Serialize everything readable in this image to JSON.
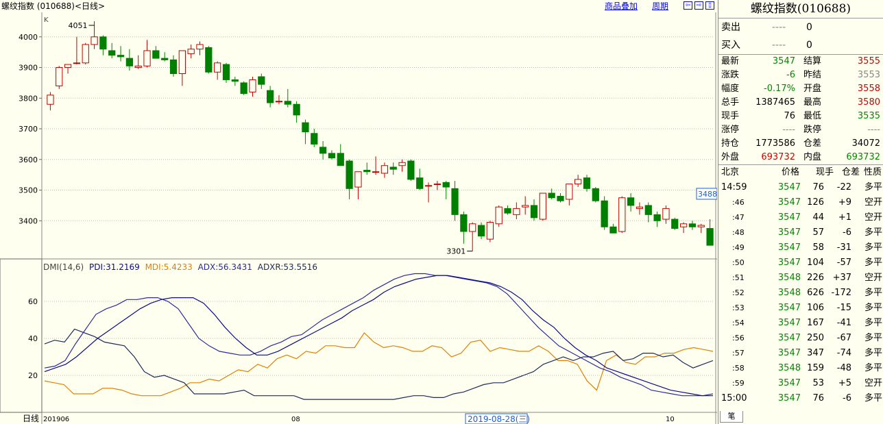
{
  "header": {
    "title": "螺纹指数 (010688)<日线>",
    "overlay_label": "商品叠加",
    "period_label": "周期"
  },
  "colors": {
    "background": "#fffff0",
    "up": "#c00000",
    "down": "#008000",
    "pdi": "#0a0a8a",
    "mdi": "#e08000",
    "adx": "#2a2aa0",
    "adxr": "#1c2a5a"
  },
  "main_chart": {
    "corner_label": "K",
    "y_ticks": [
      "4000",
      "3900",
      "3800",
      "3700",
      "3600",
      "3500",
      "3400"
    ],
    "high_marker": "4051",
    "low_marker": "3301",
    "price_tag": "3488"
  },
  "chart_data": {
    "type": "candlestick",
    "ylim": [
      3280,
      4080
    ],
    "ohlc": [
      [
        3780,
        3820,
        3760,
        3810
      ],
      [
        3840,
        3905,
        3830,
        3900
      ],
      [
        3900,
        3910,
        3880,
        3910
      ],
      [
        3915,
        4000,
        3910,
        3915
      ],
      [
        3915,
        3980,
        3910,
        3975
      ],
      [
        3975,
        4051,
        3960,
        4000
      ],
      [
        4000,
        4005,
        3940,
        3960
      ],
      [
        3955,
        3980,
        3930,
        3940
      ],
      [
        3940,
        3970,
        3920,
        3935
      ],
      [
        3930,
        3960,
        3890,
        3905
      ],
      [
        3900,
        3940,
        3895,
        3905
      ],
      [
        3905,
        3990,
        3900,
        3955
      ],
      [
        3955,
        3970,
        3930,
        3930
      ],
      [
        3930,
        3950,
        3920,
        3925
      ],
      [
        3925,
        3940,
        3870,
        3880
      ],
      [
        3880,
        3950,
        3840,
        3955
      ],
      [
        3945,
        3975,
        3930,
        3960
      ],
      [
        3960,
        3985,
        3940,
        3975
      ],
      [
        3965,
        3970,
        3880,
        3885
      ],
      [
        3885,
        3920,
        3860,
        3915
      ],
      [
        3910,
        3915,
        3850,
        3860
      ],
      [
        3860,
        3870,
        3840,
        3855
      ],
      [
        3850,
        3855,
        3810,
        3815
      ],
      [
        3820,
        3870,
        3805,
        3860
      ],
      [
        3870,
        3880,
        3830,
        3845
      ],
      [
        3825,
        3840,
        3770,
        3785
      ],
      [
        3790,
        3810,
        3780,
        3790
      ],
      [
        3790,
        3830,
        3770,
        3780
      ],
      [
        3780,
        3790,
        3720,
        3745
      ],
      [
        3720,
        3730,
        3650,
        3690
      ],
      [
        3685,
        3700,
        3640,
        3650
      ],
      [
        3640,
        3660,
        3600,
        3620
      ],
      [
        3620,
        3630,
        3600,
        3605
      ],
      [
        3620,
        3650,
        3580,
        3580
      ],
      [
        3595,
        3600,
        3470,
        3505
      ],
      [
        3510,
        3560,
        3470,
        3560
      ],
      [
        3565,
        3590,
        3550,
        3560
      ],
      [
        3560,
        3610,
        3550,
        3560
      ],
      [
        3555,
        3590,
        3540,
        3580
      ],
      [
        3575,
        3590,
        3550,
        3568
      ],
      [
        3580,
        3600,
        3560,
        3590
      ],
      [
        3595,
        3600,
        3530,
        3535
      ],
      [
        3540,
        3570,
        3500,
        3505
      ],
      [
        3515,
        3525,
        3460,
        3515
      ],
      [
        3520,
        3530,
        3500,
        3520
      ],
      [
        3525,
        3530,
        3470,
        3510
      ],
      [
        3505,
        3530,
        3400,
        3420
      ],
      [
        3420,
        3430,
        3325,
        3365
      ],
      [
        3365,
        3395,
        3301,
        3390
      ],
      [
        3385,
        3395,
        3340,
        3350
      ],
      [
        3340,
        3400,
        3330,
        3395
      ],
      [
        3390,
        3450,
        3380,
        3445
      ],
      [
        3440,
        3450,
        3420,
        3425
      ],
      [
        3420,
        3460,
        3405,
        3440
      ],
      [
        3445,
        3480,
        3420,
        3450
      ],
      [
        3450,
        3470,
        3400,
        3410
      ],
      [
        3405,
        3490,
        3400,
        3490
      ],
      [
        3490,
        3505,
        3470,
        3475
      ],
      [
        3480,
        3490,
        3460,
        3465
      ],
      [
        3470,
        3520,
        3450,
        3520
      ],
      [
        3520,
        3550,
        3510,
        3535
      ],
      [
        3540,
        3550,
        3495,
        3505
      ],
      [
        3505,
        3510,
        3460,
        3465
      ],
      [
        3465,
        3480,
        3370,
        3380
      ],
      [
        3380,
        3390,
        3360,
        3360
      ],
      [
        3365,
        3480,
        3360,
        3475
      ],
      [
        3475,
        3490,
        3430,
        3450
      ],
      [
        3440,
        3460,
        3420,
        3445
      ],
      [
        3450,
        3460,
        3395,
        3420
      ],
      [
        3420,
        3430,
        3380,
        3400
      ],
      [
        3405,
        3450,
        3390,
        3440
      ],
      [
        3405,
        3410,
        3370,
        3375
      ],
      [
        3380,
        3395,
        3360,
        3390
      ],
      [
        3390,
        3400,
        3370,
        3380
      ],
      [
        3380,
        3390,
        3360,
        3385
      ],
      [
        3375,
        3405,
        3320,
        3320
      ]
    ]
  },
  "dmi": {
    "label": "DMI(14,6)",
    "pdi_label": "PDI:31.2169",
    "mdi_label": "MDI:5.4233",
    "adx_label": "ADX:56.3431",
    "adxr_label": "ADXR:53.5516",
    "y_ticks": [
      "60",
      "40",
      "20"
    ],
    "ylim": [
      0,
      80
    ],
    "pdi": [
      17,
      16,
      15,
      10,
      10,
      10,
      13,
      13,
      12,
      10,
      9,
      9,
      9,
      11,
      13,
      16,
      16,
      18,
      17,
      20,
      23,
      22,
      26,
      24,
      29,
      31,
      29,
      33,
      32,
      36,
      36,
      35,
      35,
      43,
      38,
      35,
      36,
      35,
      33,
      33,
      36,
      35,
      30,
      32,
      38,
      39,
      33,
      35,
      34,
      33,
      33,
      36,
      33,
      28,
      28,
      26,
      17,
      12,
      28,
      31,
      27,
      26,
      30,
      30,
      32,
      32,
      34,
      35,
      34,
      33
    ],
    "mdi": [
      37,
      39,
      38,
      45,
      43,
      41,
      38,
      37,
      36,
      30,
      22,
      19,
      20,
      18,
      16,
      10,
      10,
      10,
      10,
      11,
      12,
      9,
      9,
      9,
      9,
      9,
      7,
      7,
      7,
      7,
      7,
      7,
      7,
      7,
      7,
      7,
      8,
      9,
      9,
      8,
      8,
      10,
      11,
      13,
      15,
      16,
      16,
      18,
      20,
      22,
      26,
      28,
      30,
      28,
      30,
      30,
      32,
      33,
      28,
      29,
      32,
      32,
      30,
      31,
      27,
      24,
      26,
      28
    ],
    "adx": [
      24,
      25,
      28,
      37,
      45,
      53,
      56,
      58,
      61,
      61,
      62,
      62,
      60,
      56,
      48,
      40,
      36,
      33,
      32,
      31,
      31,
      33,
      36,
      38,
      41,
      42,
      46,
      50,
      53,
      56,
      59,
      62,
      66,
      69,
      72,
      74,
      75,
      75,
      74,
      74,
      73,
      72,
      71,
      70,
      68,
      64,
      58,
      52,
      46,
      41,
      36,
      33,
      30,
      27,
      24,
      22,
      19,
      17,
      15,
      12,
      11,
      10,
      9,
      9,
      9,
      10
    ],
    "adxr": [
      22,
      24,
      26,
      30,
      35,
      40,
      44,
      48,
      52,
      56,
      59,
      61,
      62,
      62,
      62,
      59,
      53,
      46,
      40,
      35,
      31,
      31,
      33,
      36,
      39,
      42,
      45,
      48,
      51,
      55,
      58,
      61,
      65,
      68,
      70,
      72,
      73,
      74,
      74,
      73,
      72,
      71,
      70,
      68,
      65,
      61,
      55,
      50,
      46,
      40,
      35,
      31,
      28,
      24,
      22,
      20,
      18,
      16,
      14,
      12,
      11,
      10,
      9,
      9
    ]
  },
  "x_axis": {
    "period_label": "日线",
    "start_label": "201906",
    "labels": [
      "08",
      "10"
    ],
    "cursor_date": "2019-08-28(三)"
  },
  "panel": {
    "title": "螺纹指数(010688)",
    "sell": {
      "label": "卖出",
      "price": "----",
      "qty": "0"
    },
    "buy": {
      "label": "买入",
      "price": "----",
      "qty": "0"
    },
    "quotes": [
      {
        "l1": "最新",
        "v1": "3547",
        "c1": "green",
        "l2": "结算",
        "v2": "3555",
        "c2": "red"
      },
      {
        "l1": "涨跌",
        "v1": "-6",
        "c1": "green",
        "l2": "昨结",
        "v2": "3553",
        "c2": "gray"
      },
      {
        "l1": "幅度",
        "v1": "-0.17%",
        "c1": "green",
        "l2": "开盘",
        "v2": "3558",
        "c2": "red"
      },
      {
        "l1": "总手",
        "v1": "1387465",
        "c1": "black",
        "l2": "最高",
        "v2": "3580",
        "c2": "red"
      },
      {
        "l1": "现手",
        "v1": "76",
        "c1": "black",
        "l2": "最低",
        "v2": "3535",
        "c2": "green"
      },
      {
        "l1": "涨停",
        "v1": "----",
        "c1": "gray",
        "l2": "跌停",
        "v2": "----",
        "c2": "gray"
      },
      {
        "l1": "持仓",
        "v1": "1773586",
        "c1": "black",
        "l2": "仓差",
        "v2": "34072",
        "c2": "black"
      },
      {
        "l1": "外盘",
        "v1": "693732",
        "c1": "red",
        "l2": "内盘",
        "v2": "693732",
        "c2": "green"
      }
    ],
    "trades_header": {
      "time": "北京",
      "price": "价格",
      "vol": "现手",
      "oi": "仓差",
      "nature": "性质"
    },
    "trades": [
      {
        "time": "14:59",
        "price": "3547",
        "vol": "76",
        "oi": "-22",
        "nature": "多平",
        "color": "green"
      },
      {
        "time": ":46",
        "price": "3547",
        "vol": "126",
        "oi": "+9",
        "nature": "空开",
        "color": "green"
      },
      {
        "time": ":47",
        "price": "3547",
        "vol": "44",
        "oi": "+1",
        "nature": "空开",
        "color": "green"
      },
      {
        "time": ":48",
        "price": "3547",
        "vol": "57",
        "oi": "-6",
        "nature": "多平",
        "color": "green"
      },
      {
        "time": ":49",
        "price": "3547",
        "vol": "58",
        "oi": "-31",
        "nature": "多平",
        "color": "green"
      },
      {
        "time": ":50",
        "price": "3547",
        "vol": "104",
        "oi": "-57",
        "nature": "多平",
        "color": "green"
      },
      {
        "time": ":51",
        "price": "3548",
        "vol": "226",
        "oi": "+37",
        "nature": "空开",
        "color": "green"
      },
      {
        "time": ":52",
        "price": "3548",
        "vol": "626",
        "oi": "-172",
        "nature": "多平",
        "color": "green"
      },
      {
        "time": ":53",
        "price": "3547",
        "vol": "106",
        "oi": "-15",
        "nature": "多平",
        "color": "green"
      },
      {
        "time": ":54",
        "price": "3547",
        "vol": "167",
        "oi": "-41",
        "nature": "多平",
        "color": "green"
      },
      {
        "time": ":56",
        "price": "3547",
        "vol": "250",
        "oi": "-67",
        "nature": "多平",
        "color": "green"
      },
      {
        "time": ":57",
        "price": "3547",
        "vol": "347",
        "oi": "-74",
        "nature": "多平",
        "color": "green"
      },
      {
        "time": ":58",
        "price": "3548",
        "vol": "159",
        "oi": "-48",
        "nature": "多平",
        "color": "green"
      },
      {
        "time": ":59",
        "price": "3547",
        "vol": "53",
        "oi": "+5",
        "nature": "空开",
        "color": "green"
      },
      {
        "time": "15:00",
        "price": "3547",
        "vol": "76",
        "oi": "-6",
        "nature": "多平",
        "color": "black"
      }
    ],
    "tab_label": "笔"
  }
}
